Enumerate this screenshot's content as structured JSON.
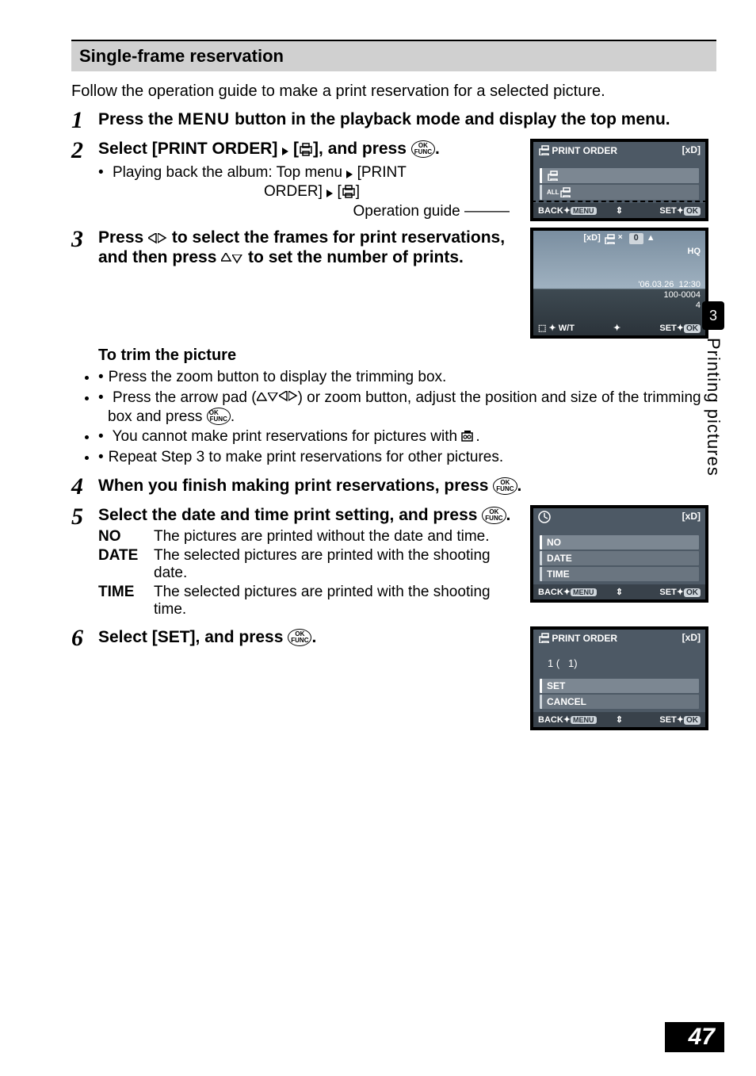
{
  "page_number": "47",
  "chapter_number": "3",
  "chapter_title": "Printing pictures",
  "section_title": "Single-frame reservation",
  "intro": "Follow the operation guide to make a print reservation for a selected picture.",
  "steps": {
    "1": {
      "title_a": "Press the ",
      "title_menu": "MENU",
      "title_b": " button in the playback mode and display the top menu."
    },
    "2": {
      "title_a": "Select [PRINT ORDER] ",
      "title_b": " [",
      "title_c": "], and press ",
      "title_d": ".",
      "bullet1a": "Playing back the album: Top menu ",
      "bullet1b": " [PRINT",
      "bullet1c": "ORDER] ",
      "bullet1d": " [",
      "bullet1e": "]",
      "opguide": "Operation guide"
    },
    "3": {
      "title_a": "Press ",
      "title_b": " to select the frames for print reservations, and then press ",
      "title_c": " to set the number of prints.",
      "subtitle": "To trim the picture",
      "b1": "Press the zoom button to display the trimming box.",
      "b2a": "Press the arrow pad (",
      "b2b": ") or zoom button, adjust the position and size of the trimming box and press ",
      "b2c": ".",
      "b3a": "You cannot make print reservations for pictures with ",
      "b3b": ".",
      "b4": "Repeat Step 3 to make print reservations for other pictures."
    },
    "4": {
      "title_a": "When you finish making print reservations, press ",
      "title_b": "."
    },
    "5": {
      "title_a": "Select the date and time print setting, and press ",
      "title_b": ".",
      "dl": {
        "no_k": "NO",
        "no_v": "The pictures are printed without the date and time.",
        "date_k": "DATE",
        "date_v": "The selected pictures are printed with the shooting date.",
        "time_k": "TIME",
        "time_v": "The selected pictures are printed with the shooting time."
      }
    },
    "6": {
      "title_a": "Select [SET], and press ",
      "title_b": "."
    }
  },
  "screens": {
    "s2": {
      "hdr_left": "PRINT ORDER",
      "hdr_right": "[xD]",
      "back": "BACK",
      "menu": "MENU",
      "set": "SET",
      "ok": "OK"
    },
    "s3": {
      "top_xd": "[xD]",
      "counter": "0",
      "hq": "HQ",
      "date": "'06.03.26",
      "time": "12:30",
      "frame": "100-0004",
      "four": "4",
      "wt": "W/T",
      "set": "SET",
      "ok": "OK"
    },
    "s5": {
      "hdr_right": "[xD]",
      "no": "NO",
      "date": "DATE",
      "time": "TIME",
      "back": "BACK",
      "menu": "MENU",
      "set": "SET",
      "ok": "OK"
    },
    "s6": {
      "hdr_left": "PRINT ORDER",
      "hdr_right": "[xD]",
      "count1": "1 (",
      "count2": "1)",
      "set": "SET",
      "cancel": "CANCEL",
      "back": "BACK",
      "menu": "MENU",
      "setf": "SET",
      "ok": "OK"
    }
  }
}
